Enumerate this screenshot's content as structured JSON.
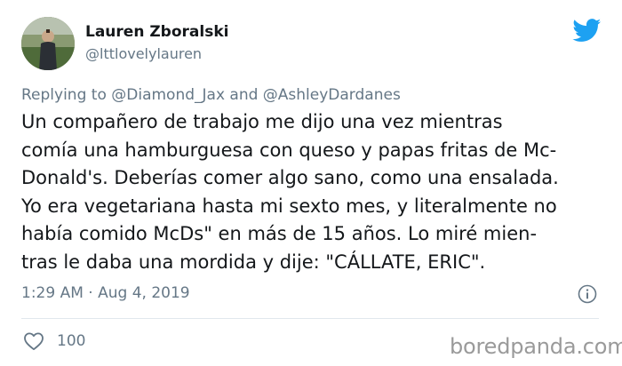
{
  "user": {
    "name": "Lauren Zboralski",
    "handle": "@lttlovelylauren"
  },
  "reply": {
    "prefix": "Replying to",
    "mention1": "@Diamond_Jax",
    "conjunction": "and",
    "mention2": "@AshleyDardanes"
  },
  "tweet": {
    "lines": [
      "Un compañero de trabajo me dijo una vez mientras",
      "comía una hamburguesa con queso y papas fritas de Mc-",
      "Donald's. Deberías comer algo sano, como una ensalada.",
      "Yo era vegetariana hasta mi sexto mes, y literalmente no",
      "había comido McDs\" en más de 15 años. Lo miré mien-",
      "tras le daba una mordida y dije: \"CÁLLATE, ERIC\"."
    ]
  },
  "meta": {
    "time": "1:29 AM",
    "separator": "·",
    "date": "Aug 4, 2019"
  },
  "actions": {
    "like_count": "100"
  },
  "watermark": "boredpanda.com",
  "colors": {
    "twitter_blue": "#1da1f2",
    "secondary_text": "#657786",
    "primary_text": "#14171a"
  },
  "icons": [
    "twitter-bird-icon",
    "info-icon",
    "heart-icon"
  ]
}
